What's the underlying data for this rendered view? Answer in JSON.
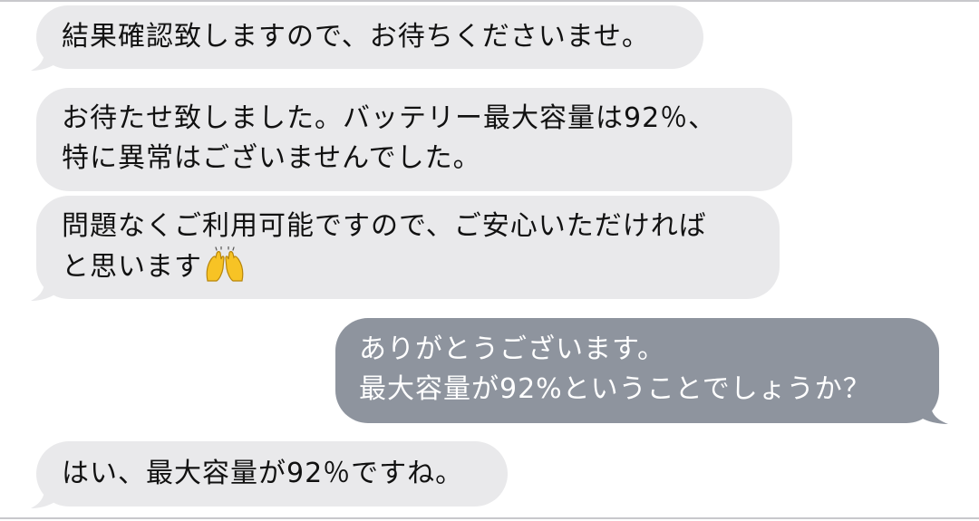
{
  "conversation": {
    "messages": [
      {
        "side": "received",
        "lines": [
          "結果確認致しますので、お待ちくださいませ。"
        ]
      },
      {
        "side": "received",
        "lines": [
          "お待たせ致しました。バッテリー最大容量は92％、",
          "特に異常はございませんでした。"
        ]
      },
      {
        "side": "received",
        "lines": [
          "問題なくご利用可能ですので、ご安心いただければ",
          "と思います"
        ],
        "emoji": "raising-hands-emoji"
      },
      {
        "side": "sent",
        "lines": [
          "ありがとうございます。",
          "最大容量が92%ということでしょうか？"
        ]
      },
      {
        "side": "received",
        "lines": [
          "はい、最大容量が92％ですね。"
        ]
      }
    ]
  },
  "colors": {
    "received_bubble": "#e9e9eb",
    "sent_bubble": "#8e949e",
    "received_text": "#111111",
    "sent_text": "#ffffff"
  }
}
